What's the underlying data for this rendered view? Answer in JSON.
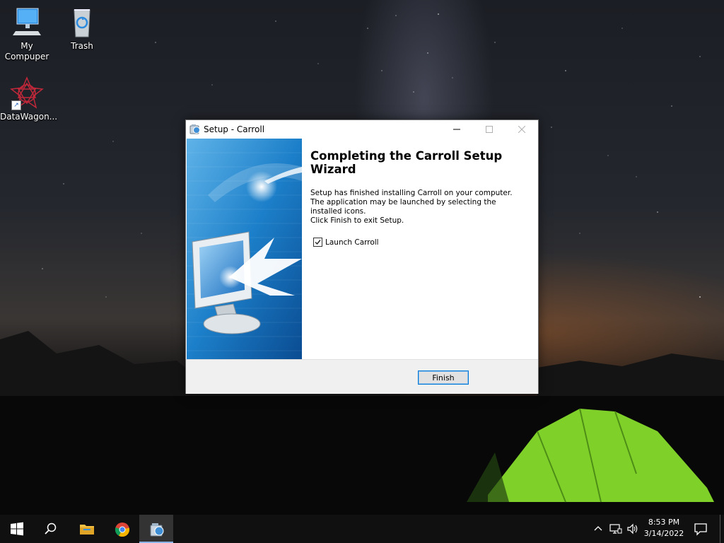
{
  "desktop": {
    "icons": [
      {
        "label": "My\nCompuper",
        "icon": "computer-icon"
      },
      {
        "label": "Trash",
        "icon": "recycle-bin-icon"
      },
      {
        "label": "DataWagon...",
        "icon": "datawagon-shortcut-icon"
      }
    ]
  },
  "window": {
    "title": "Setup - Carroll",
    "heading": "Completing the Carroll Setup Wizard",
    "description": "Setup has finished installing Carroll on your computer. The application may be launched by selecting the installed icons.",
    "exit_hint": "Click Finish to exit Setup.",
    "launch_label": "Launch Carroll",
    "launch_checked": true,
    "finish_label": "Finish"
  },
  "taskbar": {
    "items": [
      "start-icon",
      "search-icon",
      "file-explorer-icon",
      "chrome-icon",
      "setup-app-icon"
    ],
    "active_item": "setup-app-icon",
    "clock_time": "8:53 PM",
    "clock_date": "3/14/2022"
  },
  "colors": {
    "accent": "#0078d7",
    "wizard_blue": "#1c7fc9"
  }
}
